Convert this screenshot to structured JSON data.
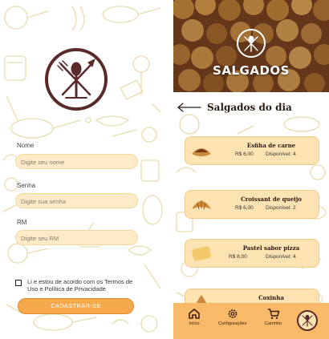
{
  "signup": {
    "name_label": "Nome",
    "name_placeholder": "Digite seu nome",
    "password_label": "Senha",
    "password_placeholder": "Digite sua senha",
    "rm_label": "RM",
    "rm_placeholder": "Digite seu RM",
    "terms_text": "Li e estou de acordo com os Termos de Uso e Política de Privacidade",
    "submit_label": "CADASTRAR-SE"
  },
  "menu": {
    "hero_title": "SALGADOS",
    "section_title": "Salgados do dia",
    "items": [
      {
        "name": "Esfiha de carne",
        "price": "R$ 6,00",
        "availability": "Disponível: 4"
      },
      {
        "name": "Croissant de queijo",
        "price": "R$ 6,00",
        "availability": "Disponível: 2"
      },
      {
        "name": "Pastel sabor pizza",
        "price": "R$ 8,00",
        "availability": "Disponível: 4"
      },
      {
        "name": "Coxinha",
        "price": "",
        "availability": ""
      }
    ]
  },
  "navbar": {
    "home_label": "Início",
    "settings_label": "Configurações",
    "cart_label": "Carrinho"
  },
  "colors": {
    "accent": "#f6a84c",
    "field_bg": "#fdebc8",
    "card_bg": "#fde3b2",
    "navbar_bg": "#f8b968",
    "logo_brown": "#5a2a2a"
  },
  "icons": [
    "cutlery-logo-icon",
    "back-arrow-icon",
    "home-icon",
    "gear-icon",
    "cart-icon"
  ]
}
